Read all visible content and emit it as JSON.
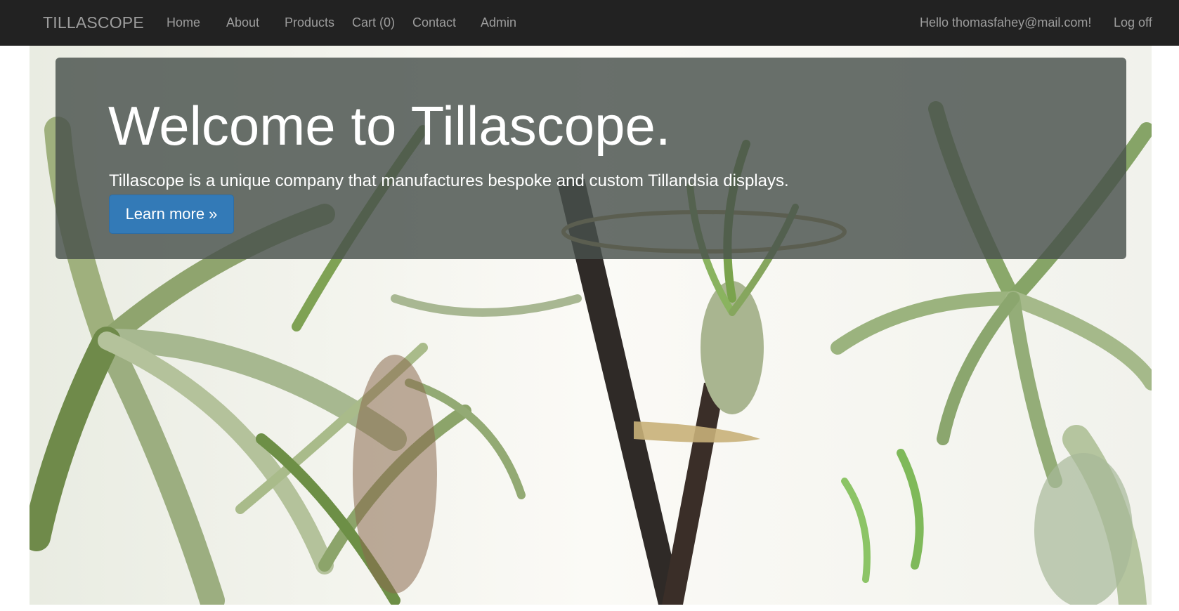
{
  "navbar": {
    "brand": "TILLASCOPE",
    "links": [
      "Home",
      "About",
      "Products",
      "Cart (0)",
      "Contact",
      "Admin"
    ],
    "greeting": "Hello thomasfahey@mail.com!",
    "logoff": "Log off"
  },
  "hero": {
    "title": "Welcome to Tillascope.",
    "lead": "Tillascope is a unique company that manufactures bespoke and custom Tillandsia displays.",
    "button_label": "Learn more »",
    "image_description_icon": "tillandsia-photo"
  },
  "colors": {
    "navbar_bg": "#222222",
    "nav_text": "#9d9d9d",
    "button_bg": "#337ab7",
    "jumbotron_overlay": "#48504c"
  }
}
